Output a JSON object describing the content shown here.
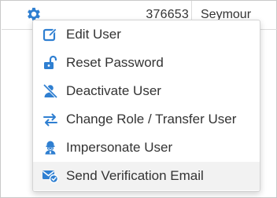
{
  "table": {
    "row": {
      "id": "376653",
      "name": "Seymour"
    }
  },
  "menu": {
    "accent_color": "#2f7fd1",
    "items": [
      {
        "label": "Edit User",
        "icon": "edit-icon"
      },
      {
        "label": "Reset Password",
        "icon": "unlock-icon"
      },
      {
        "label": "Deactivate User",
        "icon": "user-slash-icon"
      },
      {
        "label": "Change Role / Transfer User",
        "icon": "transfer-icon"
      },
      {
        "label": "Impersonate User",
        "icon": "impersonate-icon"
      },
      {
        "label": "Send Verification Email",
        "icon": "email-check-icon",
        "hovered": true
      }
    ]
  }
}
